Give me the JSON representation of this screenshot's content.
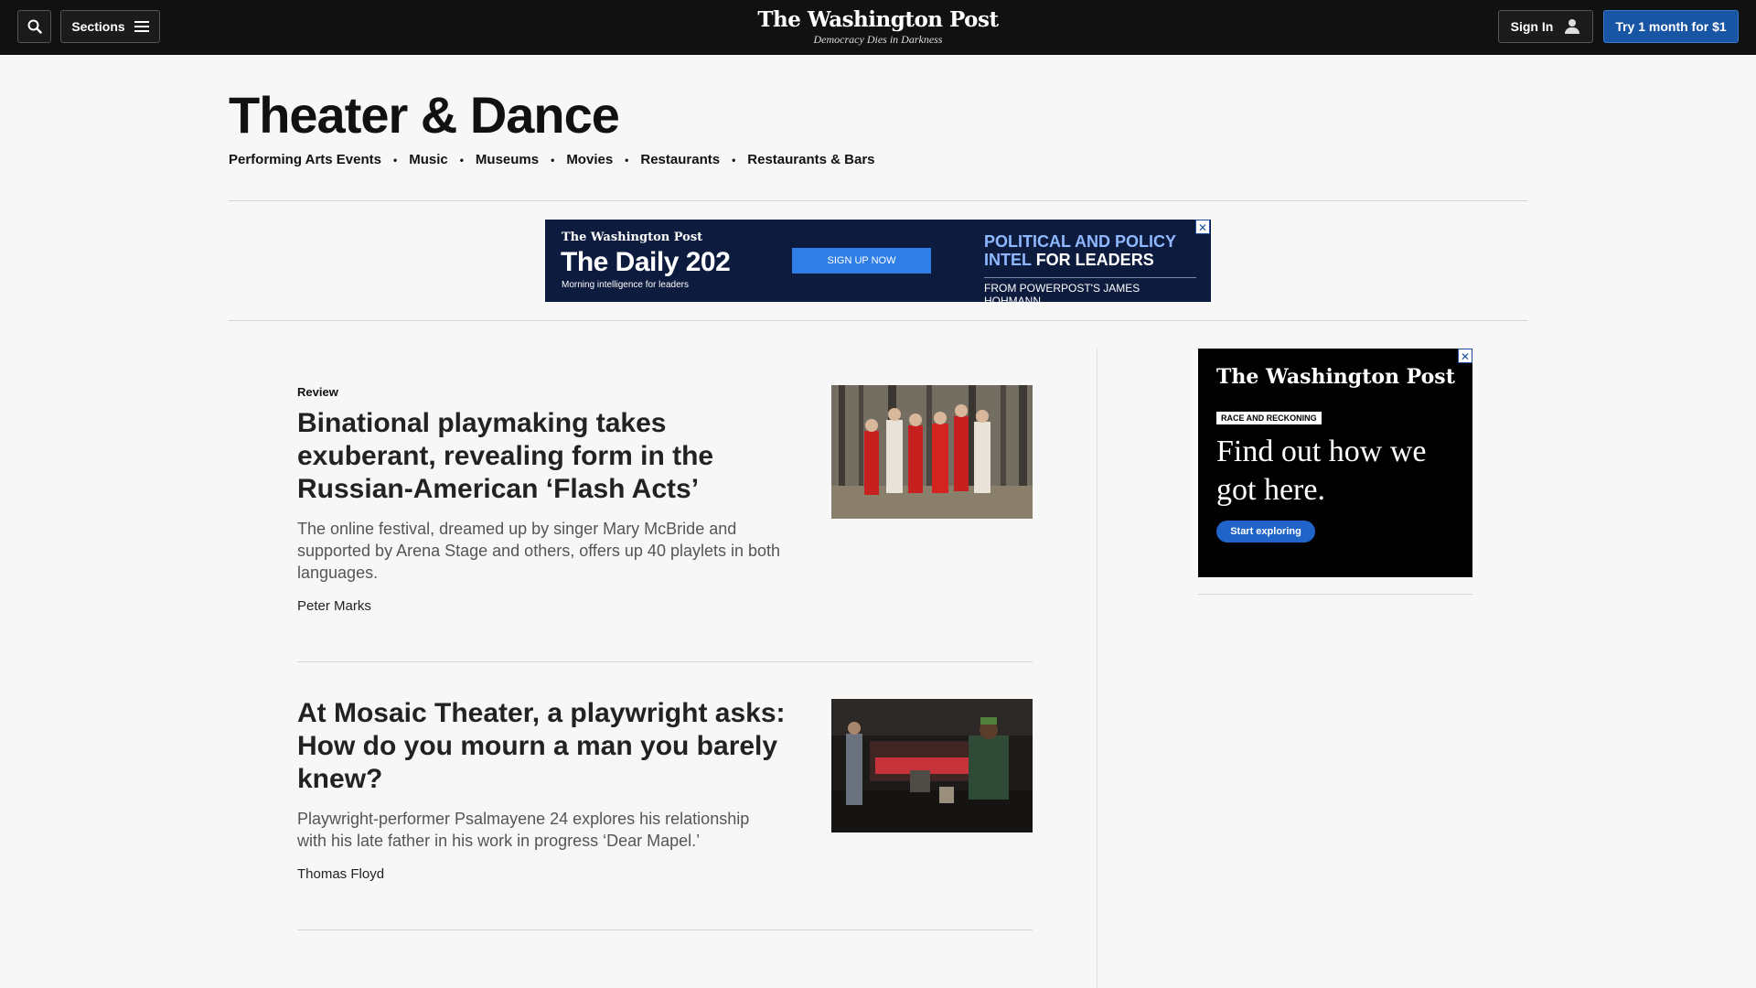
{
  "topbar": {
    "sections_label": "Sections",
    "logo": "The Washington Post",
    "tagline": "Democracy Dies in Darkness",
    "signin_label": "Sign In",
    "try_label": "Try 1 month for $1"
  },
  "page": {
    "title": "Theater & Dance",
    "subnav": [
      "Performing Arts Events",
      "Music",
      "Museums",
      "Movies",
      "Restaurants",
      "Restaurants & Bars"
    ]
  },
  "banner_ad": {
    "brand": "The Washington Post",
    "title": "The Daily 202",
    "subtitle": "Morning intelligence for leaders",
    "cta": "SIGN UP NOW",
    "line1": "POLITICAL AND POLICY",
    "line2_blue": "INTEL",
    "line2_white": "FOR LEADERS",
    "from": "FROM POWERPOST'S JAMES HOHMANN",
    "close": "✕"
  },
  "articles": [
    {
      "kicker": "Review",
      "headline": "Binational playmaking takes exuberant, revealing form in the Russian-American ‘Flash Acts’",
      "blurb": "The online festival, dreamed up by singer Mary McBride and supported by Arena Stage and others, offers up 40 playlets in both languages.",
      "byline": "Peter Marks"
    },
    {
      "kicker": "",
      "headline": "At Mosaic Theater, a playwright asks: How do you mourn a man you barely knew?",
      "blurb": "Playwright-performer Psalmayene 24 explores his relationship with his late father in his work in progress ‘Dear Mapel.’",
      "byline": "Thomas Floyd"
    }
  ],
  "side_ad": {
    "brand": "The Washington Post",
    "pill": "RACE AND RECKONING",
    "headline": "Find out how we got here.",
    "cta": "Start exploring",
    "close": "✕"
  },
  "colors": {
    "topbar": "#111111",
    "accent_blue": "#1955a5",
    "background": "#f7f7f7"
  }
}
